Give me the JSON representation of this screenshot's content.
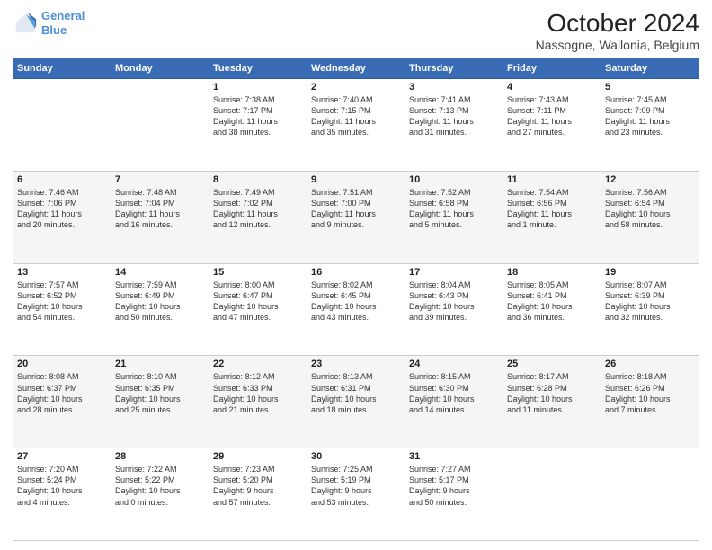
{
  "logo": {
    "line1": "General",
    "line2": "Blue"
  },
  "title": "October 2024",
  "subtitle": "Nassogne, Wallonia, Belgium",
  "weekdays": [
    "Sunday",
    "Monday",
    "Tuesday",
    "Wednesday",
    "Thursday",
    "Friday",
    "Saturday"
  ],
  "weeks": [
    [
      {
        "day": "",
        "info": ""
      },
      {
        "day": "",
        "info": ""
      },
      {
        "day": "1",
        "info": "Sunrise: 7:38 AM\nSunset: 7:17 PM\nDaylight: 11 hours\nand 38 minutes."
      },
      {
        "day": "2",
        "info": "Sunrise: 7:40 AM\nSunset: 7:15 PM\nDaylight: 11 hours\nand 35 minutes."
      },
      {
        "day": "3",
        "info": "Sunrise: 7:41 AM\nSunset: 7:13 PM\nDaylight: 11 hours\nand 31 minutes."
      },
      {
        "day": "4",
        "info": "Sunrise: 7:43 AM\nSunset: 7:11 PM\nDaylight: 11 hours\nand 27 minutes."
      },
      {
        "day": "5",
        "info": "Sunrise: 7:45 AM\nSunset: 7:09 PM\nDaylight: 11 hours\nand 23 minutes."
      }
    ],
    [
      {
        "day": "6",
        "info": "Sunrise: 7:46 AM\nSunset: 7:06 PM\nDaylight: 11 hours\nand 20 minutes."
      },
      {
        "day": "7",
        "info": "Sunrise: 7:48 AM\nSunset: 7:04 PM\nDaylight: 11 hours\nand 16 minutes."
      },
      {
        "day": "8",
        "info": "Sunrise: 7:49 AM\nSunset: 7:02 PM\nDaylight: 11 hours\nand 12 minutes."
      },
      {
        "day": "9",
        "info": "Sunrise: 7:51 AM\nSunset: 7:00 PM\nDaylight: 11 hours\nand 9 minutes."
      },
      {
        "day": "10",
        "info": "Sunrise: 7:52 AM\nSunset: 6:58 PM\nDaylight: 11 hours\nand 5 minutes."
      },
      {
        "day": "11",
        "info": "Sunrise: 7:54 AM\nSunset: 6:56 PM\nDaylight: 11 hours\nand 1 minute."
      },
      {
        "day": "12",
        "info": "Sunrise: 7:56 AM\nSunset: 6:54 PM\nDaylight: 10 hours\nand 58 minutes."
      }
    ],
    [
      {
        "day": "13",
        "info": "Sunrise: 7:57 AM\nSunset: 6:52 PM\nDaylight: 10 hours\nand 54 minutes."
      },
      {
        "day": "14",
        "info": "Sunrise: 7:59 AM\nSunset: 6:49 PM\nDaylight: 10 hours\nand 50 minutes."
      },
      {
        "day": "15",
        "info": "Sunrise: 8:00 AM\nSunset: 6:47 PM\nDaylight: 10 hours\nand 47 minutes."
      },
      {
        "day": "16",
        "info": "Sunrise: 8:02 AM\nSunset: 6:45 PM\nDaylight: 10 hours\nand 43 minutes."
      },
      {
        "day": "17",
        "info": "Sunrise: 8:04 AM\nSunset: 6:43 PM\nDaylight: 10 hours\nand 39 minutes."
      },
      {
        "day": "18",
        "info": "Sunrise: 8:05 AM\nSunset: 6:41 PM\nDaylight: 10 hours\nand 36 minutes."
      },
      {
        "day": "19",
        "info": "Sunrise: 8:07 AM\nSunset: 6:39 PM\nDaylight: 10 hours\nand 32 minutes."
      }
    ],
    [
      {
        "day": "20",
        "info": "Sunrise: 8:08 AM\nSunset: 6:37 PM\nDaylight: 10 hours\nand 28 minutes."
      },
      {
        "day": "21",
        "info": "Sunrise: 8:10 AM\nSunset: 6:35 PM\nDaylight: 10 hours\nand 25 minutes."
      },
      {
        "day": "22",
        "info": "Sunrise: 8:12 AM\nSunset: 6:33 PM\nDaylight: 10 hours\nand 21 minutes."
      },
      {
        "day": "23",
        "info": "Sunrise: 8:13 AM\nSunset: 6:31 PM\nDaylight: 10 hours\nand 18 minutes."
      },
      {
        "day": "24",
        "info": "Sunrise: 8:15 AM\nSunset: 6:30 PM\nDaylight: 10 hours\nand 14 minutes."
      },
      {
        "day": "25",
        "info": "Sunrise: 8:17 AM\nSunset: 6:28 PM\nDaylight: 10 hours\nand 11 minutes."
      },
      {
        "day": "26",
        "info": "Sunrise: 8:18 AM\nSunset: 6:26 PM\nDaylight: 10 hours\nand 7 minutes."
      }
    ],
    [
      {
        "day": "27",
        "info": "Sunrise: 7:20 AM\nSunset: 5:24 PM\nDaylight: 10 hours\nand 4 minutes."
      },
      {
        "day": "28",
        "info": "Sunrise: 7:22 AM\nSunset: 5:22 PM\nDaylight: 10 hours\nand 0 minutes."
      },
      {
        "day": "29",
        "info": "Sunrise: 7:23 AM\nSunset: 5:20 PM\nDaylight: 9 hours\nand 57 minutes."
      },
      {
        "day": "30",
        "info": "Sunrise: 7:25 AM\nSunset: 5:19 PM\nDaylight: 9 hours\nand 53 minutes."
      },
      {
        "day": "31",
        "info": "Sunrise: 7:27 AM\nSunset: 5:17 PM\nDaylight: 9 hours\nand 50 minutes."
      },
      {
        "day": "",
        "info": ""
      },
      {
        "day": "",
        "info": ""
      }
    ]
  ]
}
